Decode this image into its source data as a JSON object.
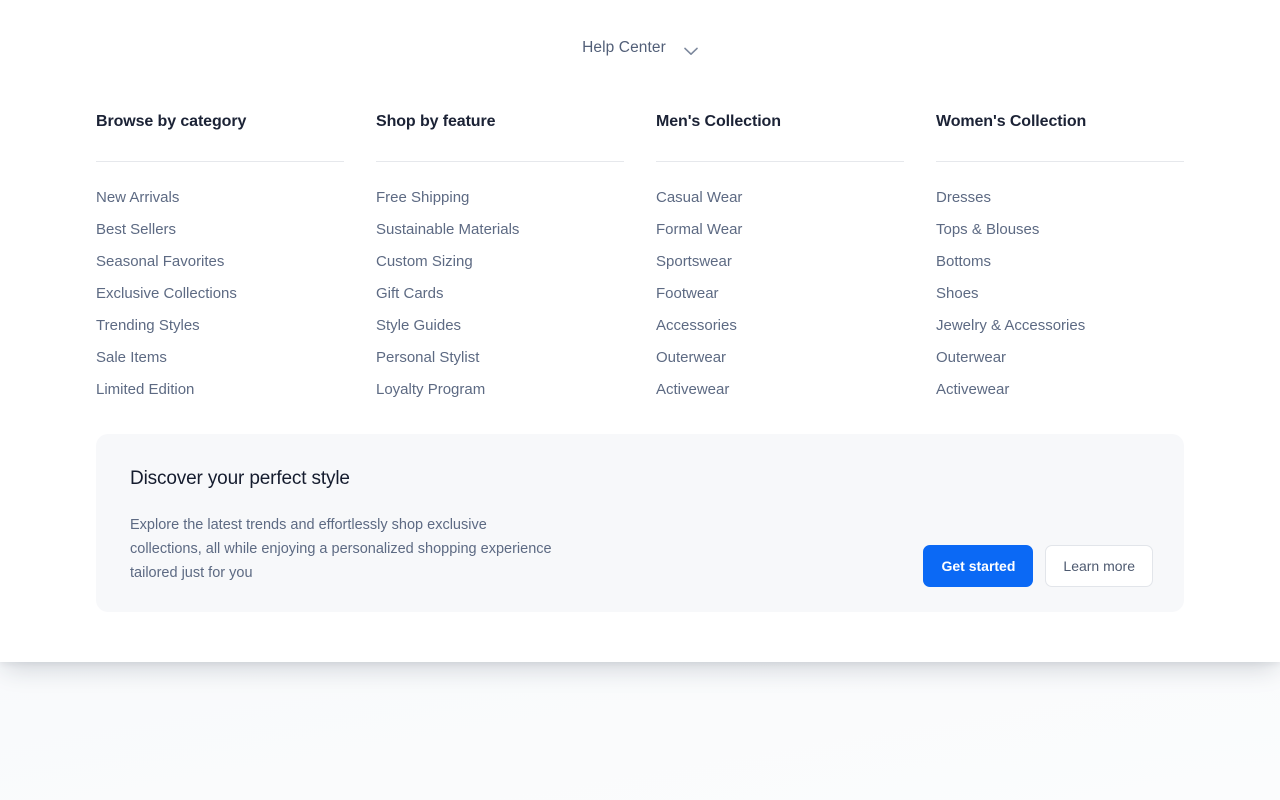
{
  "trigger": {
    "label": "Help Center",
    "icon": "chevron-down-icon"
  },
  "columns": [
    {
      "heading": "Browse by category",
      "links": [
        "New Arrivals",
        "Best Sellers",
        "Seasonal Favorites",
        "Exclusive Collections",
        "Trending Styles",
        "Sale Items",
        "Limited Edition"
      ]
    },
    {
      "heading": "Shop by feature",
      "links": [
        "Free Shipping",
        "Sustainable Materials",
        "Custom Sizing",
        "Gift Cards",
        "Style Guides",
        "Personal Stylist",
        "Loyalty Program"
      ]
    },
    {
      "heading": "Men's Collection",
      "links": [
        "Casual Wear",
        "Formal Wear",
        "Sportswear",
        "Footwear",
        "Accessories",
        "Outerwear",
        "Activewear"
      ]
    },
    {
      "heading": "Women's Collection",
      "links": [
        "Dresses",
        "Tops & Blouses",
        "Bottoms",
        "Shoes",
        "Jewelry & Accessories",
        "Outerwear",
        "Activewear"
      ]
    }
  ],
  "promo": {
    "title": "Discover your perfect style",
    "body": "Explore the latest trends and effortlessly shop exclusive collections, all while enjoying a personalized shopping experience tailored just for you",
    "primary_button": "Get started",
    "secondary_button": "Learn more"
  },
  "colors": {
    "accent": "#0b69f5",
    "heading": "#1b2235",
    "link": "#5d6a83",
    "card_bg": "#f7f8fa",
    "rule": "#e6e8ec",
    "panel_bg": "#ffffff"
  }
}
